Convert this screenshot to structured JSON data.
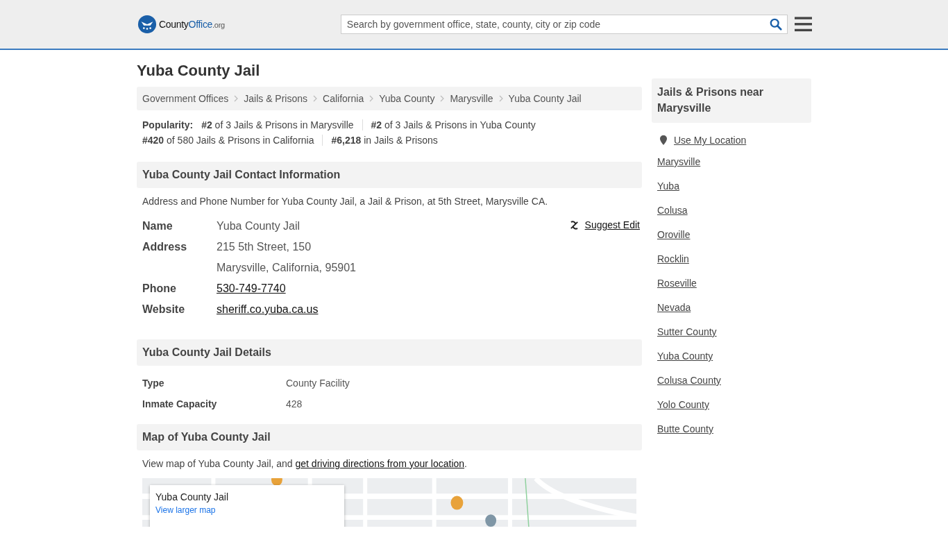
{
  "header": {
    "logo": {
      "part1": "County",
      "part2": "Office",
      "part3": ".org"
    },
    "search": {
      "placeholder": "Search by government office, state, county, city or zip code"
    }
  },
  "title": "Yuba County Jail",
  "breadcrumbs": [
    "Government Offices",
    "Jails & Prisons",
    "California",
    "Yuba County",
    "Marysville",
    "Yuba County Jail"
  ],
  "popularity": {
    "label": "Popularity:",
    "items": [
      "**#2** of 3 Jails & Prisons in Marysville",
      "**#2** of 3 Jails & Prisons in Yuba County",
      "**#420** of 580 Jails & Prisons in California",
      "**#6,218** in Jails & Prisons"
    ]
  },
  "contact": {
    "heading": "Yuba County Jail Contact Information",
    "intro": "Address and Phone Number for Yuba County Jail, a Jail & Prison, at 5th Street, Marysville CA.",
    "suggest_edit": "Suggest Edit",
    "rows": [
      {
        "label": "Name",
        "values": [
          "Yuba County Jail"
        ],
        "kind": "text"
      },
      {
        "label": "Address",
        "values": [
          "215 5th Street, 150",
          "Marysville, California, 95901"
        ],
        "kind": "text"
      },
      {
        "label": "Phone",
        "values": [
          "530-749-7740"
        ],
        "kind": "link"
      },
      {
        "label": "Website",
        "values": [
          "sheriff.co.yuba.ca.us"
        ],
        "kind": "link"
      }
    ]
  },
  "details": {
    "heading": "Yuba County Jail Details",
    "rows": [
      {
        "label": "Type",
        "value": "County Facility"
      },
      {
        "label": "Inmate Capacity",
        "value": "428"
      }
    ]
  },
  "map": {
    "heading": "Map of Yuba County Jail",
    "intro_before": "View map of Yuba County Jail, and ",
    "intro_link": "get driving directions from your location",
    "intro_after": ".",
    "card_title": "Yuba County Jail",
    "card_link": "View larger map"
  },
  "sidebar": {
    "heading": "Jails & Prisons near Marysville",
    "use_location": "Use My Location",
    "links": [
      "Marysville",
      "Yuba",
      "Colusa",
      "Oroville",
      "Rocklin",
      "Roseville",
      "Nevada",
      "Sutter County",
      "Yuba County",
      "Colusa County",
      "Yolo County",
      "Butte County"
    ]
  }
}
